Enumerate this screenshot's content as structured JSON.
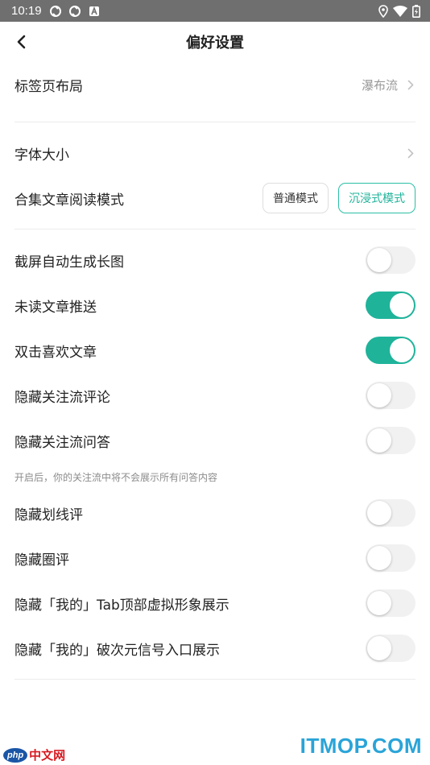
{
  "status_bar": {
    "time": "10:19",
    "left_icons": [
      "sync-icon",
      "sync-icon",
      "notification-a-icon"
    ],
    "right_icons": [
      "location-icon",
      "wifi-icon",
      "battery-icon"
    ]
  },
  "nav": {
    "title": "偏好设置"
  },
  "settings": {
    "tab_layout": {
      "label": "标签页布局",
      "value": "瀑布流"
    },
    "font_size": {
      "label": "字体大小"
    },
    "collection_read_mode": {
      "label": "合集文章阅读模式",
      "options": [
        "普通模式",
        "沉浸式模式"
      ],
      "selected": "沉浸式模式"
    },
    "toggles": [
      {
        "label": "截屏自动生成长图",
        "on": false
      },
      {
        "label": "未读文章推送",
        "on": true
      },
      {
        "label": "双击喜欢文章",
        "on": true
      },
      {
        "label": "隐藏关注流评论",
        "on": false
      },
      {
        "label": "隐藏关注流问答",
        "on": false
      }
    ],
    "hint": "开启后，你的关注流中将不会展示所有问答内容",
    "toggles2": [
      {
        "label": "隐藏划线评",
        "on": false
      },
      {
        "label": "隐藏圈评",
        "on": false
      },
      {
        "label": "隐藏「我的」Tab顶部虚拟形象展示",
        "on": false
      },
      {
        "label": "隐藏「我的」破次元信号入口展示",
        "on": false
      }
    ]
  },
  "watermarks": {
    "left_badge": "php",
    "left_text": "中文网",
    "right_text": "ITMOP.COM"
  },
  "colors": {
    "accent": "#1fb39a",
    "status_bar": "#6f6f6f"
  }
}
